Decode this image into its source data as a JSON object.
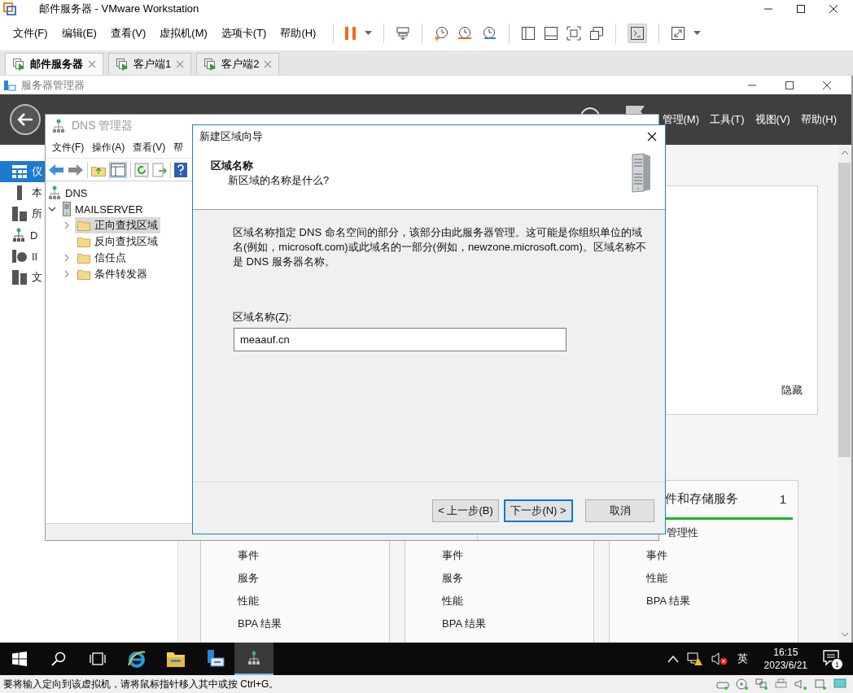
{
  "vmware": {
    "title": "邮件服务器 - VMware Workstation",
    "menu": [
      "文件(F)",
      "编辑(E)",
      "查看(V)",
      "虚拟机(M)",
      "选项卡(T)",
      "帮助(H)"
    ],
    "console_view": {
      "on": true
    },
    "tabs": [
      {
        "label": "邮件服务器",
        "selected": true
      },
      {
        "label": "客户端1",
        "selected": false
      },
      {
        "label": "客户端2",
        "selected": false
      }
    ],
    "status_text": "要将输入定向到该虚拟机，请将鼠标指针移入其中或按 Ctrl+G。"
  },
  "server_manager": {
    "title": "服务器管理器",
    "menu": [
      "管理(M)",
      "工具(T)",
      "视图(V)",
      "帮助(H)"
    ],
    "sidebar": [
      {
        "label": "仪",
        "kind": "dashboard",
        "selected": true
      },
      {
        "label": "本",
        "kind": "local",
        "selected": false
      },
      {
        "label": "所",
        "kind": "all",
        "selected": false
      },
      {
        "label": "D",
        "kind": "dns",
        "selected": false
      },
      {
        "label": "II",
        "kind": "iis",
        "selected": false
      },
      {
        "label": "文",
        "kind": "files",
        "selected": false
      }
    ],
    "hide_link": "隐藏",
    "tiles": [
      {
        "items": [
          "事件",
          "服务",
          "性能",
          "BPA 结果"
        ]
      },
      {
        "items": [
          "事件",
          "服务",
          "性能",
          "BPA 结果"
        ]
      },
      {
        "title": "件和存储服务",
        "count": "1",
        "items": [
          "管理性",
          "事件",
          "性能",
          "BPA 结果"
        ]
      }
    ]
  },
  "dns_manager": {
    "title": "DNS 管理器",
    "menu": [
      "文件(F)",
      "操作(A)",
      "查看(V)",
      "帮"
    ],
    "tree": [
      {
        "label": "DNS",
        "kind": "dns",
        "selected": false,
        "children": [
          {
            "label": "MAILSERVER",
            "kind": "server",
            "expanded": true,
            "selected": false,
            "children": [
              {
                "label": "正向查找区域",
                "kind": "folder",
                "expanded": false,
                "selected": true
              },
              {
                "label": "反向查找区域",
                "kind": "folder",
                "selected": false
              },
              {
                "label": "信任点",
                "kind": "folder",
                "expanded": false,
                "selected": false
              },
              {
                "label": "条件转发器",
                "kind": "folder",
                "expanded": false,
                "selected": false
              }
            ]
          }
        ]
      }
    ]
  },
  "wizard": {
    "title": "新建区域向导",
    "heading": "区域名称",
    "subheading": "新区域的名称是什么?",
    "description": "区域名称指定 DNS 命名空间的部分，该部分由此服务器管理。这可能是你组织单位的域名(例如，microsoft.com)或此域名的一部分(例如，newzone.microsoft.com)。区域名称不是 DNS 服务器名称。",
    "field_label": "区域名称(Z):",
    "field_value": "meaauf.cn",
    "buttons": [
      {
        "label": "< 上一步(B)",
        "default": false
      },
      {
        "label": "下一步(N) >",
        "default": true
      },
      {
        "label": "取消",
        "default": false
      }
    ]
  },
  "taskbar": {
    "apps": [
      {
        "kind": "ie",
        "selected": false
      },
      {
        "kind": "folder",
        "selected": false
      },
      {
        "kind": "server-manager",
        "selected": false
      },
      {
        "kind": "dns",
        "selected": true
      }
    ],
    "language": "英",
    "time": "16:15",
    "date": "2023/6/21",
    "notification_count": "1"
  }
}
